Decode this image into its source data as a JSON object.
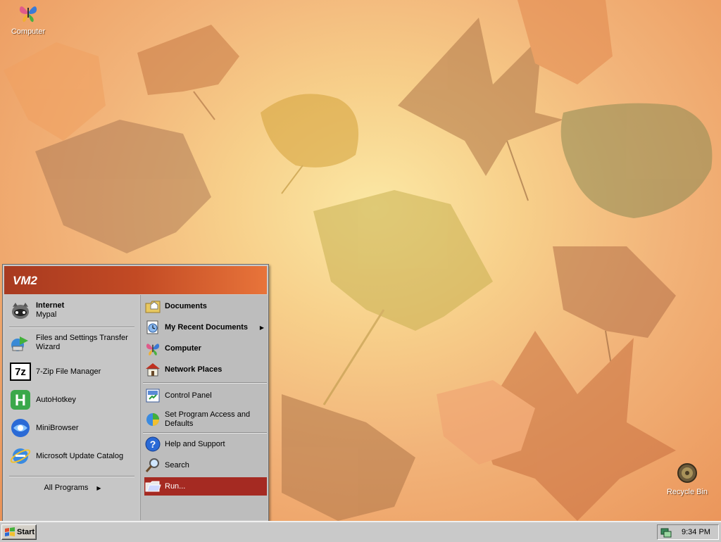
{
  "desktop": {
    "icons": [
      {
        "label": "Computer"
      },
      {
        "label": "Recycle Bin"
      }
    ]
  },
  "start_menu": {
    "user_name": "VM2",
    "pinned": [
      {
        "title": "Internet",
        "subtitle": "Mypal"
      }
    ],
    "recent_programs": [
      {
        "label": "Files and Settings Transfer Wizard"
      },
      {
        "label": "7-Zip File Manager"
      },
      {
        "label": "AutoHotkey"
      },
      {
        "label": "MiniBrowser"
      },
      {
        "label": "Microsoft Update Catalog"
      }
    ],
    "all_programs_label": "All Programs",
    "places": [
      {
        "label": "Documents"
      },
      {
        "label": "My Recent Documents"
      },
      {
        "label": "Computer"
      },
      {
        "label": "Network Places"
      }
    ],
    "settings": [
      {
        "label": "Control Panel"
      },
      {
        "label": "Set Program Access and Defaults"
      }
    ],
    "help": [
      {
        "label": "Help and Support"
      },
      {
        "label": "Search"
      },
      {
        "label": "Run..."
      }
    ],
    "colors": {
      "header_start": "#a83a20",
      "header_end": "#e8743a",
      "highlight": "#a52a22"
    }
  },
  "taskbar": {
    "start_label": "Start",
    "clock": "9:34 PM"
  }
}
